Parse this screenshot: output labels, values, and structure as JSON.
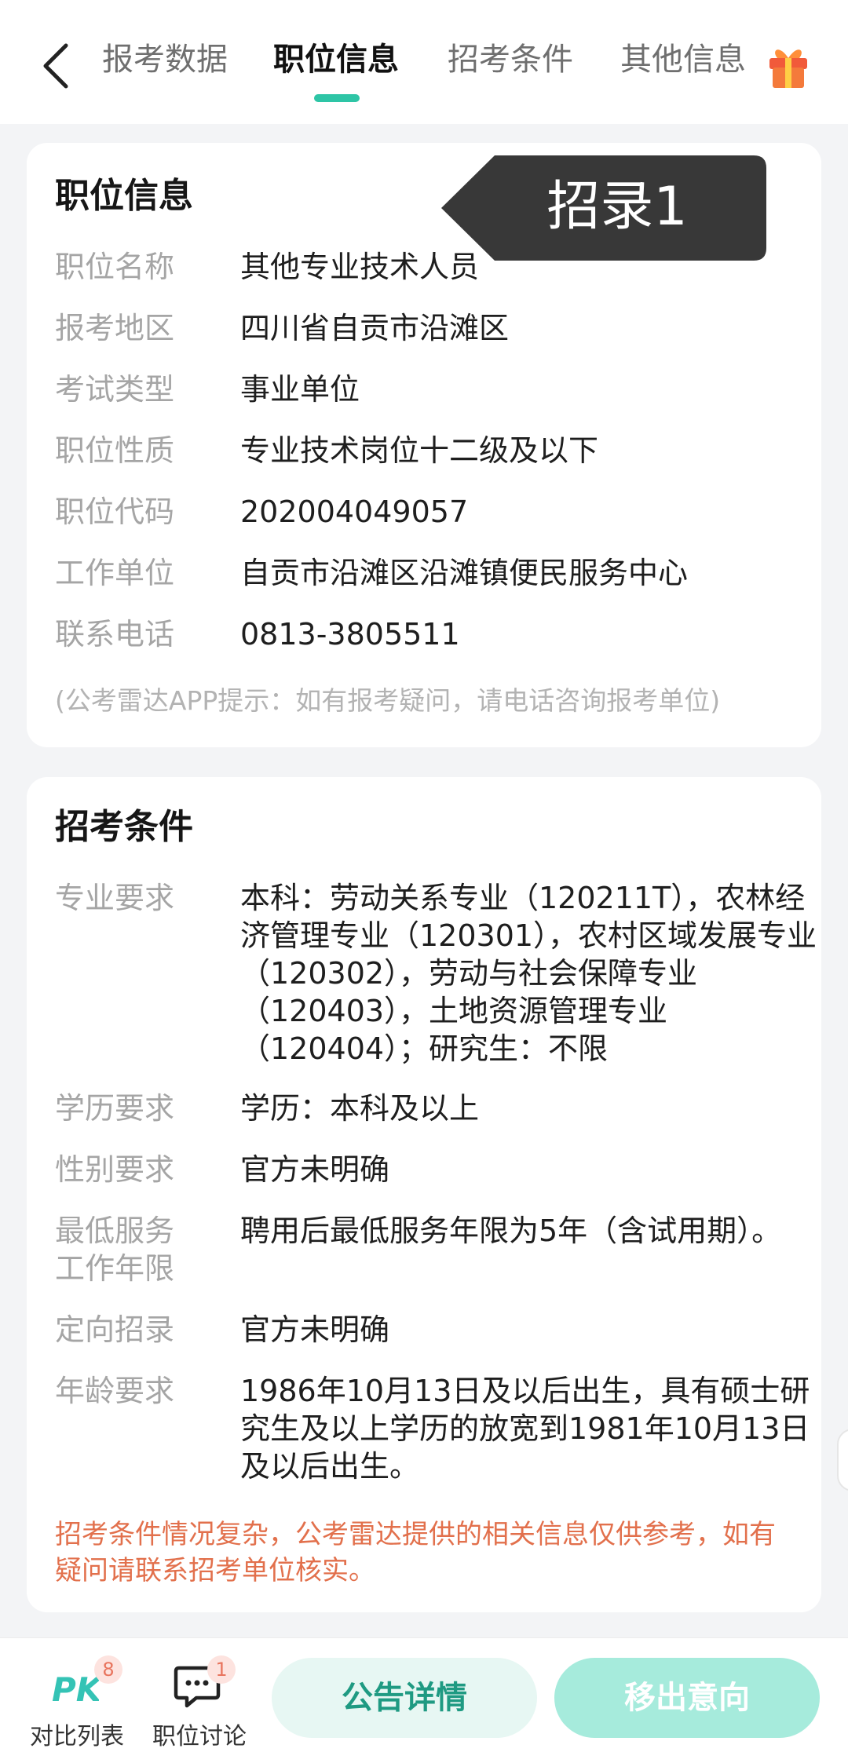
{
  "nav": {
    "tabs": [
      {
        "label": "报考数据"
      },
      {
        "label": "职位信息"
      },
      {
        "label": "招考条件"
      },
      {
        "label": "其他信息"
      }
    ],
    "active_tab": "职位信息"
  },
  "flag": {
    "label": "招录1"
  },
  "job_info": {
    "title": "职位信息",
    "rows": [
      {
        "label": "职位名称",
        "value": "其他专业技术人员"
      },
      {
        "label": "报考地区",
        "value": "四川省自贡市沿滩区"
      },
      {
        "label": "考试类型",
        "value": "事业单位"
      },
      {
        "label": "职位性质",
        "value": "专业技术岗位十二级及以下"
      },
      {
        "label": "职位代码",
        "value": "202004049057"
      },
      {
        "label": "工作单位",
        "value": "自贡市沿滩区沿滩镇便民服务中心"
      },
      {
        "label": "联系电话",
        "value": "0813-3805511"
      }
    ],
    "hint": "(公考雷达APP提示：如有报考疑问，请电话咨询报考单位)"
  },
  "conditions": {
    "title": "招考条件",
    "rows": [
      {
        "label": "专业要求",
        "value": "本科：劳动关系专业（120211T），农林经济管理专业（120301），农村区域发展专业（120302），劳动与社会保障专业（120403），土地资源管理专业（120404）；研究生：不限"
      },
      {
        "label": "学历要求",
        "value": "学历：本科及以上"
      },
      {
        "label": "性别要求",
        "value": "官方未明确"
      },
      {
        "label": "最低服务工作年限",
        "value": "聘用后最低服务年限为5年（含试用期）。"
      },
      {
        "label": "定向招录",
        "value": "官方未明确"
      },
      {
        "label": "年龄要求",
        "value": "1986年10月13日及以后出生，具有硕士研究生及以上学历的放宽到1981年10月13日及以后出生。"
      }
    ],
    "warning": "招考条件情况复杂，公考雷达提供的相关信息仅供参考，如有疑问请联系招考单位核实。"
  },
  "bottom": {
    "compare": {
      "label": "对比列表",
      "badge": "8",
      "icon": "pk-icon"
    },
    "discuss": {
      "label": "职位讨论",
      "badge": "1",
      "icon": "chat-icon"
    },
    "notice_button": "公告详情",
    "remove_button": "移出意向"
  },
  "colors": {
    "accent": "#2ec5a6",
    "warning": "#e2704c",
    "flag_bg": "#383838"
  }
}
